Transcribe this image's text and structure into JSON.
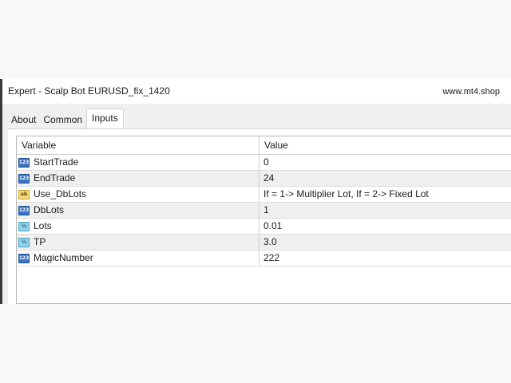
{
  "window": {
    "title": "Expert - Scalp Bot EURUSD_fix_1420",
    "watermark": "www.mt4.shop"
  },
  "tabs": [
    {
      "label": "About",
      "active": false
    },
    {
      "label": "Common",
      "active": false
    },
    {
      "label": "Inputs",
      "active": true
    }
  ],
  "grid": {
    "columns": [
      "Variable",
      "Value"
    ],
    "rows": [
      {
        "variable": "StartTrade",
        "value": "0",
        "type_icon": "integer-icon",
        "icon_text": "123"
      },
      {
        "variable": "EndTrade",
        "value": "24",
        "type_icon": "integer-icon",
        "icon_text": "123"
      },
      {
        "variable": "Use_DbLots",
        "value": "If = 1-> Multiplier Lot, If = 2-> Fixed Lot",
        "type_icon": "string-icon",
        "icon_text": "ab"
      },
      {
        "variable": "DbLots",
        "value": "1",
        "type_icon": "integer-icon",
        "icon_text": "123"
      },
      {
        "variable": "Lots",
        "value": "0.01",
        "type_icon": "double-icon",
        "icon_text": "½"
      },
      {
        "variable": "TP",
        "value": "3.0",
        "type_icon": "double-icon",
        "icon_text": "½"
      },
      {
        "variable": "MagicNumber",
        "value": "222",
        "type_icon": "integer-icon",
        "icon_text": "123"
      }
    ]
  }
}
